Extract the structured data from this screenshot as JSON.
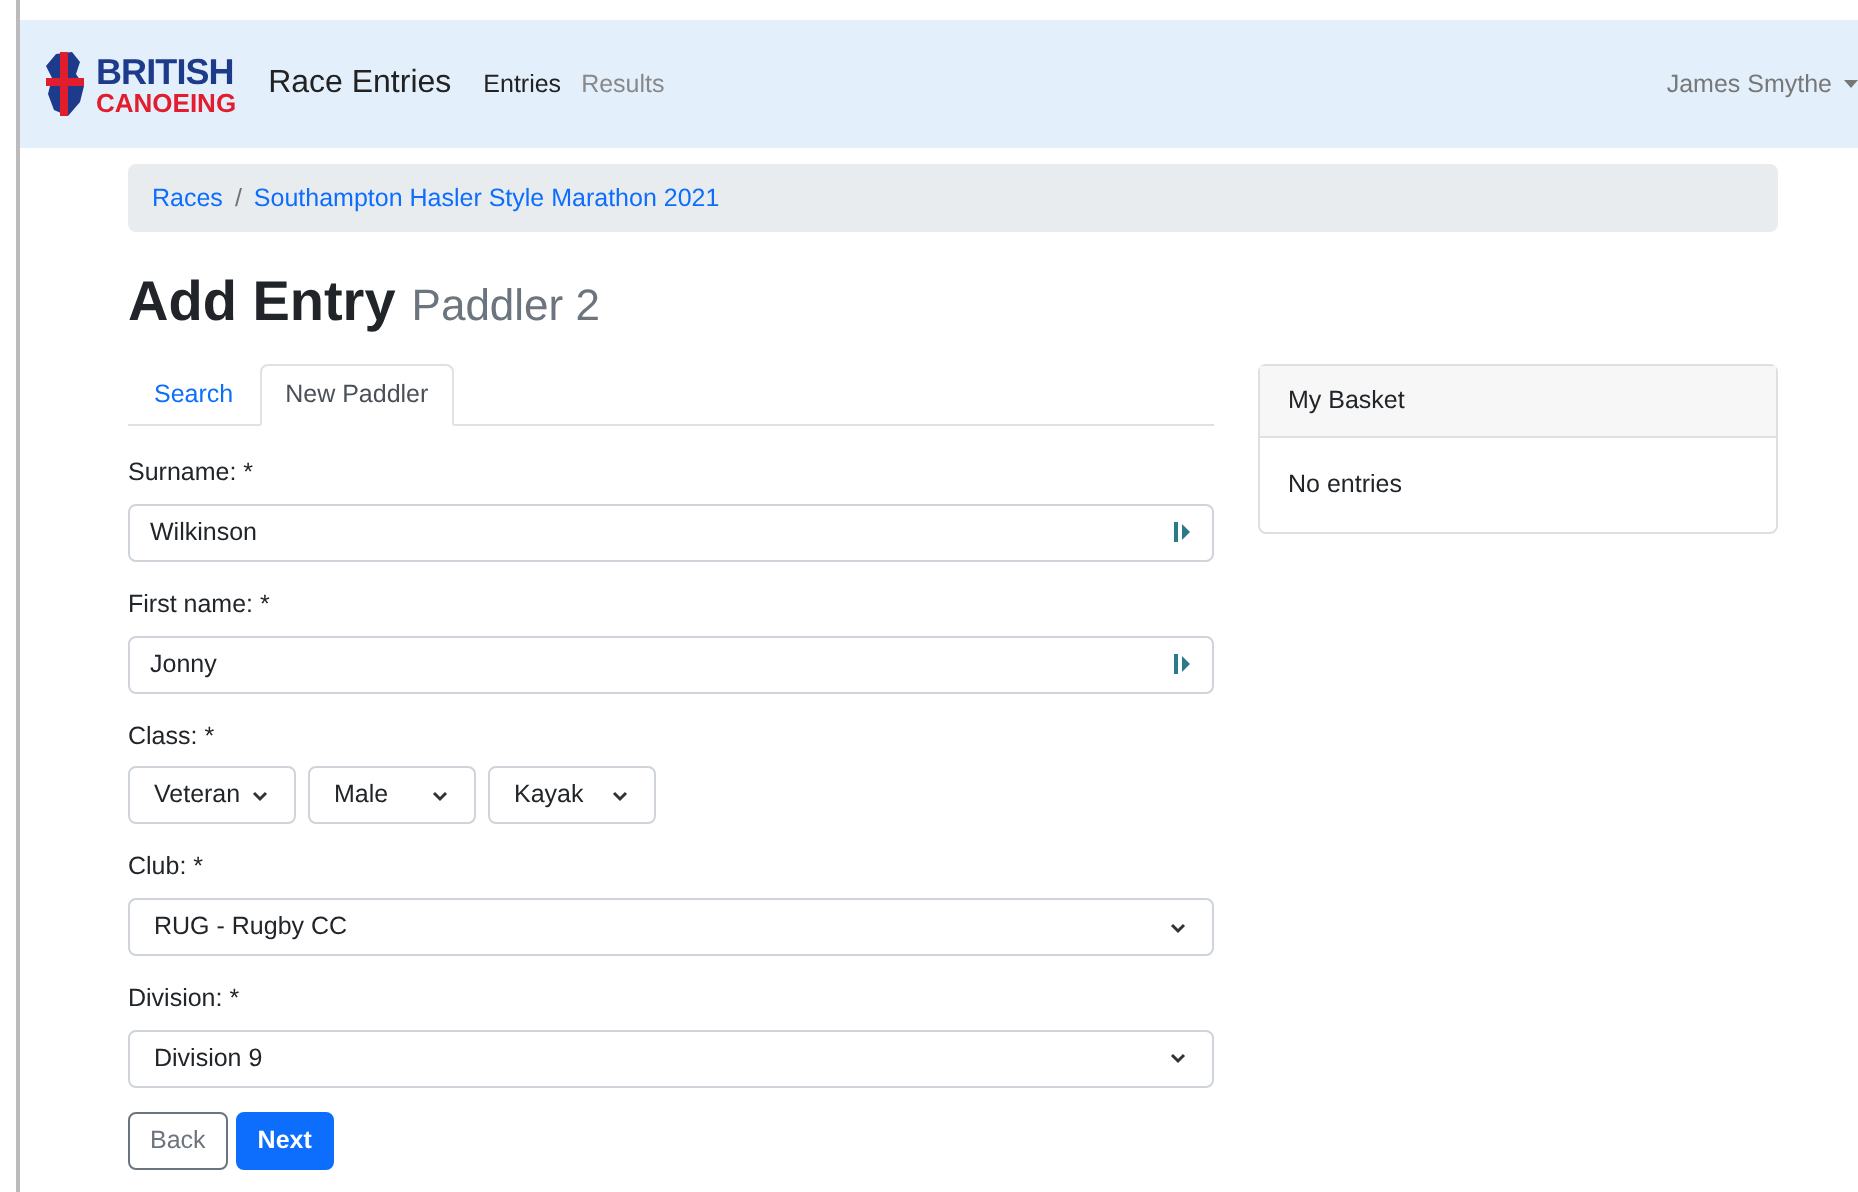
{
  "logo": {
    "line_1": "BRITISH",
    "line_2": "CANOEING"
  },
  "navbar": {
    "brand": "Race Entries",
    "links": [
      {
        "label": "Entries",
        "selected": true
      },
      {
        "label": "Results",
        "selected": false
      }
    ],
    "user": "James Smythe"
  },
  "breadcrumb": {
    "separator": "/",
    "items": [
      "Races",
      "Southampton Hasler Style Marathon 2021"
    ]
  },
  "heading": {
    "title": "Add Entry",
    "subtitle": "Paddler 2"
  },
  "tabs": [
    {
      "label": "Search",
      "selected": false
    },
    {
      "label": "New Paddler",
      "selected": true
    }
  ],
  "form": [
    {
      "kind": "text",
      "label": "Surname: *",
      "value": "Wilkinson"
    },
    {
      "kind": "text",
      "label": "First name: *",
      "value": "Jonny"
    },
    {
      "kind": "selects",
      "label": "Class: *",
      "values": [
        "Veteran",
        "Male",
        "Kayak"
      ]
    },
    {
      "kind": "select",
      "label": "Club: *",
      "value": "RUG - Rugby CC"
    },
    {
      "kind": "select",
      "label": "Division: *",
      "value": "Division 9"
    }
  ],
  "buttons": [
    {
      "label": "Back",
      "kind": "secondary"
    },
    {
      "label": "Next",
      "kind": "primary"
    }
  ],
  "basket": {
    "title": "My Basket",
    "body": "No entries"
  }
}
